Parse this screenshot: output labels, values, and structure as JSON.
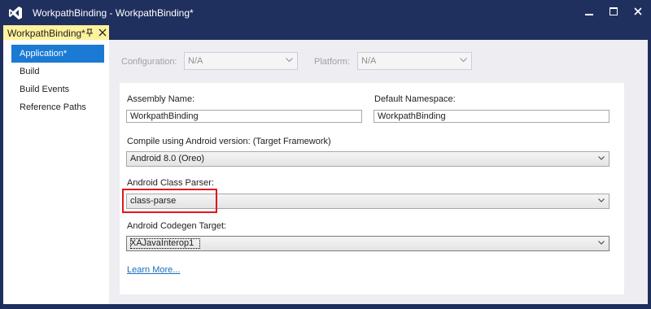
{
  "window": {
    "title": "WorkpathBinding - WorkpathBinding*",
    "logo_icon": "visual-studio-logo-icon",
    "controls": [
      "minimize-icon",
      "maximize-icon",
      "close-icon"
    ]
  },
  "tab": {
    "label": "WorkpathBinding*",
    "pin_icon": "pin-icon",
    "close_icon": "close-icon"
  },
  "sidebar": {
    "items": [
      {
        "label": "Application*",
        "active": true
      },
      {
        "label": "Build",
        "active": false
      },
      {
        "label": "Build Events",
        "active": false
      },
      {
        "label": "Reference Paths",
        "active": false
      }
    ]
  },
  "config_bar": {
    "configuration_label": "Configuration:",
    "configuration_value": "N/A",
    "platform_label": "Platform:",
    "platform_value": "N/A",
    "enabled": false
  },
  "form": {
    "assembly_name_label": "Assembly Name:",
    "assembly_name_value": "WorkpathBinding",
    "default_namespace_label": "Default Namespace:",
    "default_namespace_value": "WorkpathBinding",
    "compile_label": "Compile using Android version:  (Target Framework)",
    "compile_value": "Android 8.0 (Oreo)",
    "class_parser_label": "Android Class Parser:",
    "class_parser_value": "class-parse",
    "codegen_label": "Android Codegen Target:",
    "codegen_value": "XAJavaInterop1",
    "learn_more": "Learn More..."
  },
  "colors": {
    "titlebar": "#1f2f5e",
    "tab_active": "#fff29d",
    "nav_selected": "#1b7ad3",
    "pane_background": "#eeeef2",
    "highlight": "#e0161c",
    "link": "#1a6ebd"
  }
}
